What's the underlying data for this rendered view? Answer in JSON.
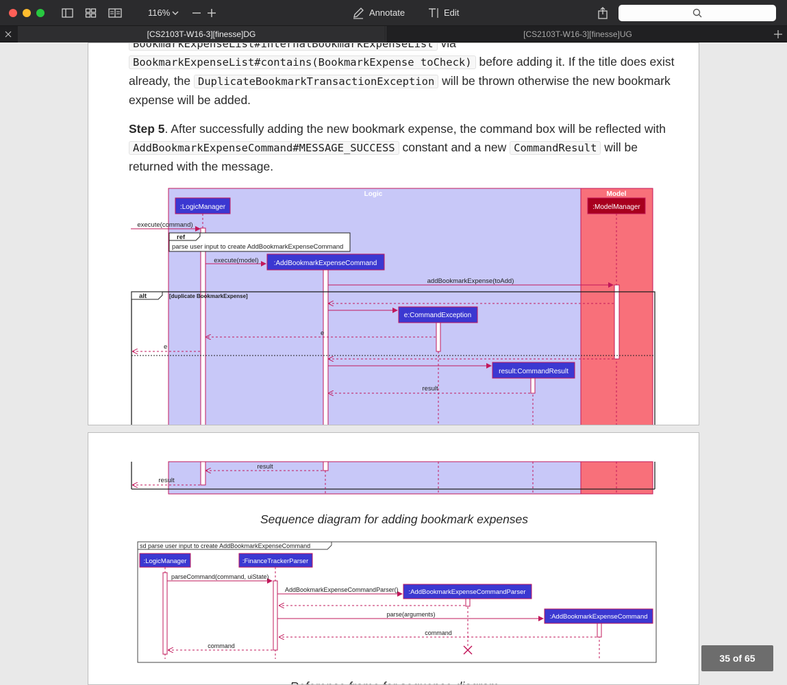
{
  "toolbar": {
    "zoom": "116%",
    "annotate_label": "Annotate",
    "edit_label": "Edit",
    "search_placeholder": ""
  },
  "tabs": [
    {
      "label": "[CS2103T-W16-3][finesse]DG",
      "active": true
    },
    {
      "label": "[CS2103T-W16-3][finesse]UG",
      "active": false
    }
  ],
  "page1": {
    "line0": "BookmarkExpenseList#internalBookmarkExpenseList",
    "line0_suffix": " via",
    "p1": {
      "code1": "BookmarkExpenseList#contains(BookmarkExpense toCheck)",
      "t1": " before adding it. If the title does exist already, the ",
      "code2": "DuplicateBookmarkTransactionException",
      "t2": " will be thrown otherwise the new bookmark expense will be added."
    },
    "p2": {
      "bold": "Step 5",
      "t1": ". After successfully adding the new bookmark expense, the command box will be reflected with ",
      "code1": "AddBookmarkExpenseCommand#MESSAGE_SUCCESS",
      "t2": " constant and a new ",
      "code2": "CommandResult",
      "t3": " will be returned with the message."
    }
  },
  "diagram1": {
    "logic_label": "Logic",
    "model_label": "Model",
    "logic_manager": ":LogicManager",
    "model_manager": ":ModelManager",
    "msg_execute_command": "execute(command)",
    "ref_label": "ref",
    "ref_text": "parse user input to create AddBookmarkExpenseCommand",
    "msg_execute_model": "execute(model)",
    "add_cmd": ":AddBookmarkExpenseCommand",
    "msg_add": "addBookmarkExpense(toAdd)",
    "alt_label": "alt",
    "alt_guard": "[duplicate BookmarkExpense]",
    "exception": "e:CommandException",
    "msg_e1": "e",
    "msg_e2": "e",
    "command_result": "result:CommandResult",
    "msg_result1": "result",
    "msg_result2": "result",
    "msg_result3": "result"
  },
  "page2": {
    "caption": "Sequence diagram for adding bookmark expenses",
    "next_caption": "Reference frame for sequence diagram"
  },
  "diagram2": {
    "frame_label": "sd parse user input to create AddBookmarkExpenseCommand",
    "logic_manager": ":LogicManager",
    "parser": ":FinanceTrackerParser",
    "cmd_parser": ":AddBookmarkExpenseCommandParser",
    "cmd": ":AddBookmarkExpenseCommand",
    "msg_parse": "parseCommand(command, uiState)",
    "msg_create_parser": "AddBookmarkExpenseCommandParser()",
    "msg_parse_args": "parse(arguments)",
    "msg_command1": "command",
    "msg_command2": "command"
  },
  "page_indicator": "35 of 65",
  "colors": {
    "logic_bg": "#c8c8f8",
    "model_bg": "#f8707a",
    "lifeline_box": "#3b38d1",
    "message": "#c2185b"
  }
}
